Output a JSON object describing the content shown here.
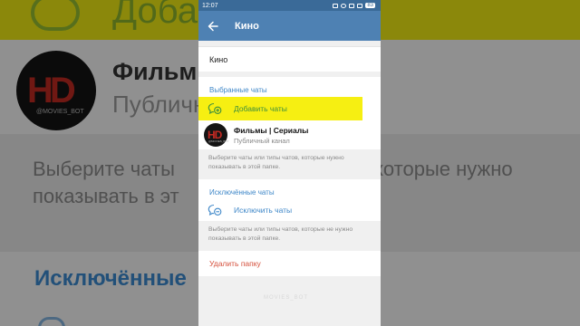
{
  "background": {
    "add_text": "Добавить",
    "channel_name": "Фильм",
    "channel_status": "Публичн",
    "hint_line1": "Выберите чаты",
    "hint_line1_right": "которые нужно",
    "hint_line2": "показывать в эт",
    "excluded_title": "Исключённые"
  },
  "statusbar": {
    "time": "12:07",
    "battery": "83"
  },
  "appbar": {
    "title": "Кино"
  },
  "folder": {
    "name": "Кино"
  },
  "included": {
    "title": "Выбранные чаты",
    "add_label": "Добавить чаты",
    "chats": [
      {
        "name": "Фильмы | Сериалы",
        "subtitle": "Публичный канал",
        "avatar_mark": "HD",
        "avatar_sub": "@MOVIES_BOT"
      }
    ],
    "hint": "Выберите чаты или типы чатов, которые нужно показывать в этой папке."
  },
  "excluded": {
    "title": "Исключённые чаты",
    "exclude_label": "Исключить чаты",
    "hint": "Выберите чаты или типы чатов, которые не нужно показывать в этой папке."
  },
  "actions": {
    "delete_label": "Удалить папку"
  },
  "watermark": "MOVIES_BOT",
  "colors": {
    "appbar": "#4e81b3",
    "section_title": "#3e87c8",
    "add": "#3f8f3c",
    "delete": "#d5503c",
    "highlight": "#f6ef12"
  }
}
